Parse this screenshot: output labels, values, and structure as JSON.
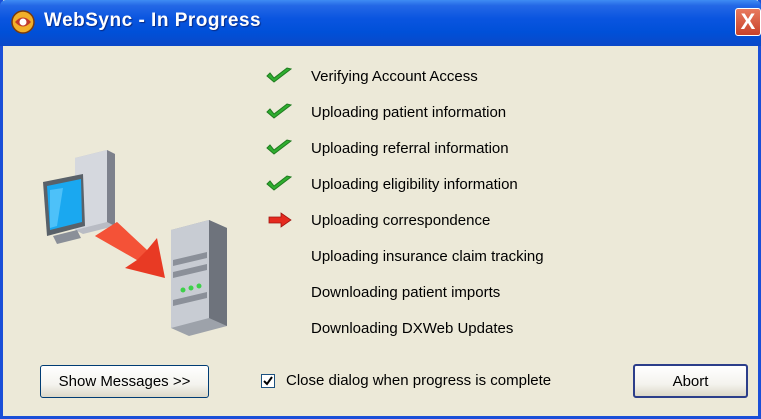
{
  "window": {
    "title": "WebSync - In Progress",
    "close_label": "X"
  },
  "steps": [
    {
      "label": "Verifying Account Access",
      "status": "complete",
      "icon": "check-icon"
    },
    {
      "label": "Uploading patient information",
      "status": "complete",
      "icon": "check-icon"
    },
    {
      "label": "Uploading referral information",
      "status": "complete",
      "icon": "check-icon"
    },
    {
      "label": "Uploading  eligibility information",
      "status": "complete",
      "icon": "check-icon"
    },
    {
      "label": "Uploading correspondence",
      "status": "in-progress",
      "icon": "arrow-right-icon"
    },
    {
      "label": "Uploading insurance claim tracking",
      "status": "pending",
      "icon": ""
    },
    {
      "label": "Downloading patient imports",
      "status": "pending",
      "icon": ""
    },
    {
      "label": "Downloading DXWeb Updates",
      "status": "pending",
      "icon": ""
    }
  ],
  "footer": {
    "show_messages_label": "Show Messages >>",
    "close_when_complete_label": "Close dialog when progress is complete",
    "close_when_complete_checked": true,
    "abort_label": "Abort"
  },
  "colors": {
    "titlebar": "#0050d8",
    "dialog_bg": "#ece9d8",
    "check": "#2fae2f",
    "arrow": "#e52a1f"
  }
}
